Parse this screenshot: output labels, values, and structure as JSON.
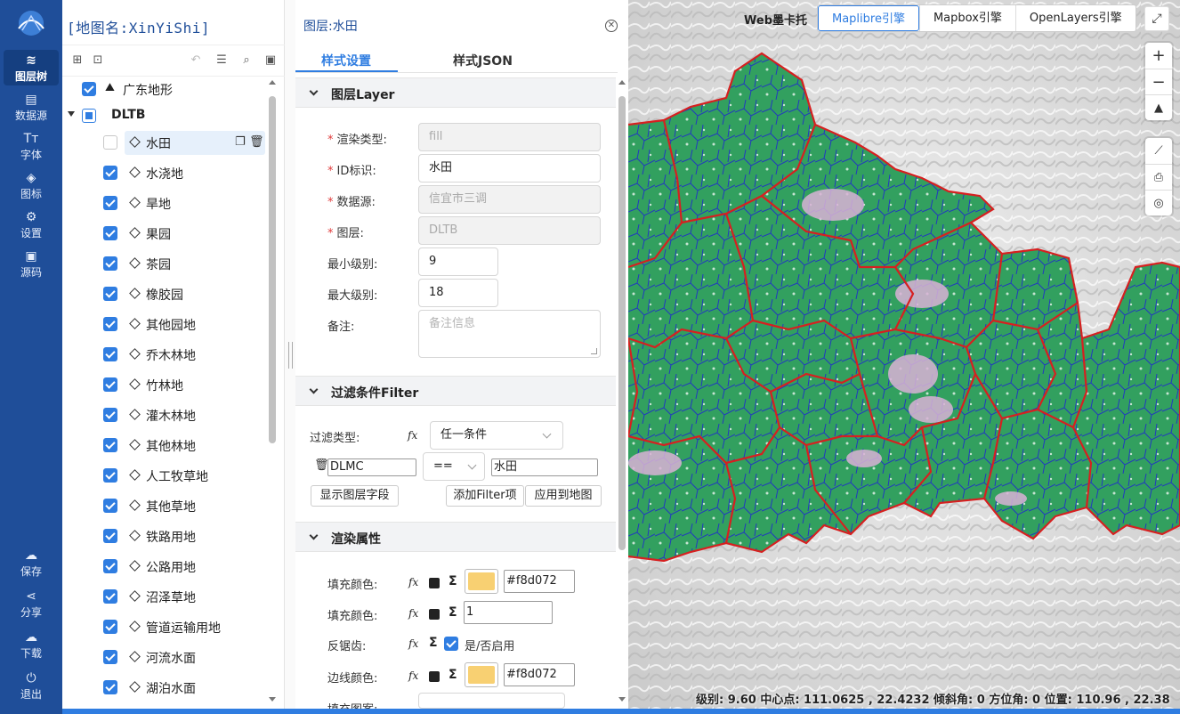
{
  "app": {
    "map_name": "[地图名:XinYiShi]"
  },
  "nav": {
    "items": [
      {
        "label": "图层树",
        "icon": "layers-icon",
        "active": true
      },
      {
        "label": "数据源",
        "icon": "database-icon"
      },
      {
        "label": "字体",
        "icon": "font-icon"
      },
      {
        "label": "图标",
        "icon": "sprite-icon"
      },
      {
        "label": "设置",
        "icon": "gear-icon"
      },
      {
        "label": "源码",
        "icon": "code-icon"
      }
    ],
    "bottom": [
      {
        "label": "保存",
        "icon": "cloud-save-icon"
      },
      {
        "label": "分享",
        "icon": "share-icon"
      },
      {
        "label": "下载",
        "icon": "cloud-download-icon"
      },
      {
        "label": "退出",
        "icon": "exit-icon"
      }
    ]
  },
  "tree": {
    "root_layer": "广东地形",
    "group": "DLTB",
    "layers": [
      {
        "label": "水田",
        "checked": false,
        "selected": true
      },
      {
        "label": "水浇地",
        "checked": true
      },
      {
        "label": "旱地",
        "checked": true
      },
      {
        "label": "果园",
        "checked": true
      },
      {
        "label": "茶园",
        "checked": true
      },
      {
        "label": "橡胶园",
        "checked": true
      },
      {
        "label": "其他园地",
        "checked": true
      },
      {
        "label": "乔木林地",
        "checked": true
      },
      {
        "label": "竹林地",
        "checked": true
      },
      {
        "label": "灌木林地",
        "checked": true
      },
      {
        "label": "其他林地",
        "checked": true
      },
      {
        "label": "人工牧草地",
        "checked": true
      },
      {
        "label": "其他草地",
        "checked": true
      },
      {
        "label": "铁路用地",
        "checked": true
      },
      {
        "label": "公路用地",
        "checked": true
      },
      {
        "label": "沼泽草地",
        "checked": true
      },
      {
        "label": "管道运输用地",
        "checked": true
      },
      {
        "label": "河流水面",
        "checked": true
      },
      {
        "label": "湖泊水面",
        "checked": true
      }
    ]
  },
  "style_panel": {
    "title": "图层:水田",
    "tabs": [
      "样式设置",
      "样式JSON"
    ],
    "sections": {
      "layer": "图层Layer",
      "filter": "过滤条件Filter",
      "render": "渲染属性"
    },
    "layer_form": {
      "render_type_label": "渲染类型:",
      "render_type_value": "fill",
      "id_label": "ID标识:",
      "id_value": "水田",
      "source_label": "数据源:",
      "source_value": "信宜市三调",
      "source_layer_label": "图层:",
      "source_layer_value": "DLTB",
      "minzoom_label": "最小级别:",
      "minzoom_value": "9",
      "maxzoom_label": "最大级别:",
      "maxzoom_value": "18",
      "note_label": "备注:",
      "note_placeholder": "备注信息"
    },
    "filter_form": {
      "type_label": "过滤类型:",
      "type_value": "任一条件",
      "field": "DLMC",
      "operator": "==",
      "value": "水田",
      "show_fields_btn": "显示图层字段",
      "add_filter_btn": "添加Filter项",
      "apply_btn": "应用到地图"
    },
    "render_form": {
      "fill_color_label": "填充颜色:",
      "fill_color_value": "#f8d072",
      "fill_opacity_label": "填充颜色:",
      "fill_opacity_value": "1",
      "antialias_label": "反锯齿:",
      "antialias_text": "是/否启用",
      "outline_color_label": "边线颜色:",
      "outline_color_value": "#f8d072",
      "pattern_label": "填充图案:"
    }
  },
  "map": {
    "engine_label": "Web墨卡托",
    "engines": [
      "Maplibre引擎",
      "Mapbox引擎",
      "OpenLayers引擎"
    ],
    "active_engine": "Maplibre引擎",
    "status": "级别: 9.60 中心点: 111.0625 , 22.4232 倾斜角: 0 方位角: 0 位置: 110.96 , 22.38"
  },
  "colors": {
    "nav_bg": "#1f4e99",
    "accent": "#2f7de1",
    "land_green": "#32a05f",
    "boundary_red": "#d62020",
    "parcel_blue": "#1f2ec9",
    "fill_swatch": "#f8d072"
  }
}
